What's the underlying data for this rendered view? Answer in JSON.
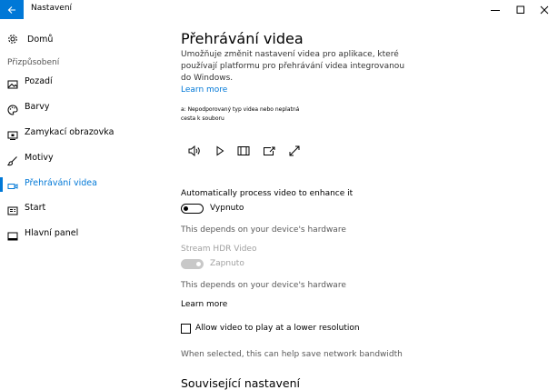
{
  "window": {
    "title": "Nastavení",
    "accent": "#0078d7"
  },
  "sidebar": {
    "home_label": "Domů",
    "section_label": "Přizpůsobení",
    "items": [
      {
        "label": "Pozadí",
        "icon": "picture-icon"
      },
      {
        "label": "Barvy",
        "icon": "palette-icon"
      },
      {
        "label": "Zamykací obrazovka",
        "icon": "lock-screen-icon"
      },
      {
        "label": "Motivy",
        "icon": "brush-icon"
      },
      {
        "label": "Přehrávání videa",
        "icon": "video-icon",
        "active": true
      },
      {
        "label": "Start",
        "icon": "start-icon"
      },
      {
        "label": "Hlavní panel",
        "icon": "taskbar-icon"
      }
    ]
  },
  "main": {
    "title": "Přehrávání videa",
    "description": "Umožňuje změnit nastavení videa pro aplikace, které používají platformu pro přehrávání videa integrovanou do Windows.",
    "learn_more": "Learn more",
    "video_error": "a: Nepodporovaný typ videa nebo neplatná cesta k souboru",
    "controls": [
      "volume-icon",
      "play-icon",
      "aspect-icon",
      "cast-icon",
      "fullscreen-icon"
    ],
    "auto_process": {
      "label": "Automatically process video to enhance it",
      "state": "Vypnuto",
      "note": "This depends on your device's hardware"
    },
    "hdr": {
      "label": "Stream HDR Video",
      "state": "Zapnuto",
      "note": "This depends on your device's hardware"
    },
    "learn_more_2": "Learn more",
    "lower_res": {
      "label": "Allow video to play at a lower resolution",
      "note": "When selected, this can help save network bandwidth"
    },
    "related_heading": "Související nastavení"
  }
}
